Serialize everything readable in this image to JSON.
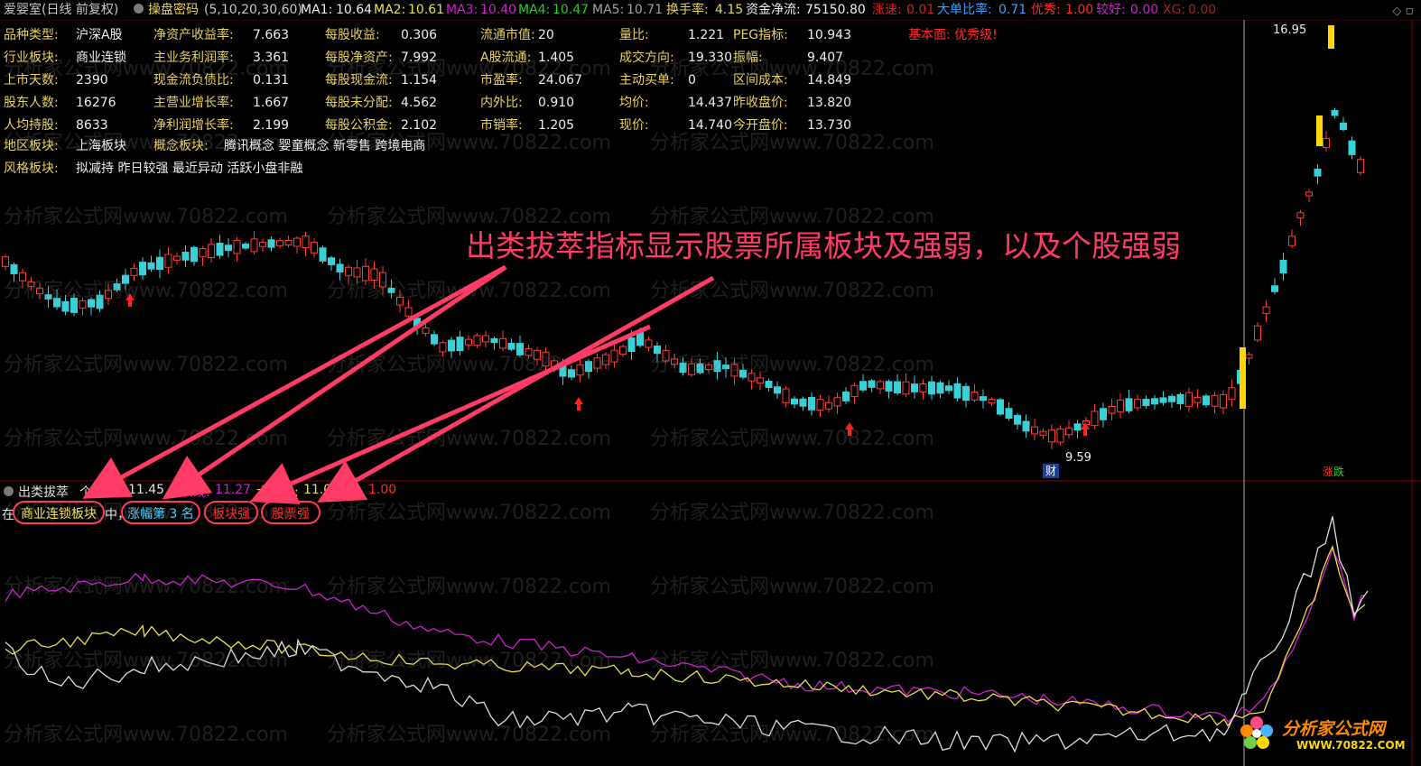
{
  "topbar": {
    "title": "爱婴室(日线 前复权)",
    "indicator_name": "操盘密码",
    "indicator_params": "(5,10,20,30,60)",
    "ma1_label": "MA1:",
    "ma1_value": "10.64",
    "ma2_label": "MA2:",
    "ma2_value": "10.61",
    "ma3_label": "MA3:",
    "ma3_value": "10.40",
    "ma4_label": "MA4:",
    "ma4_value": "10.47",
    "ma5_label": "MA5:",
    "ma5_value": "10.71",
    "turnover_label": "换手率:",
    "turnover_value": "4.15",
    "netflow_label": "资金净流:",
    "netflow_value": "75150.80",
    "speed_label": "涨速:",
    "speed_value": "0.01",
    "bigorder_label": "大单比率:",
    "bigorder_value": "0.71",
    "excellent_label": "优秀:",
    "excellent_value": "1.00",
    "better_label": "较好:",
    "better_value": "0.00",
    "xg_label": "XG:",
    "xg_value": "0.00",
    "right_icon": "diamond-icon"
  },
  "info": {
    "col1": [
      {
        "label": "品种类型:",
        "value": "沪深A股"
      },
      {
        "label": "行业板块:",
        "value": "商业连锁"
      },
      {
        "label": "上市天数:",
        "value": "2390"
      },
      {
        "label": "股东人数:",
        "value": "16276"
      },
      {
        "label": "人均持股:",
        "value": "8633"
      }
    ],
    "col2": [
      {
        "label": "净资产收益率:",
        "value": "7.663"
      },
      {
        "label": "主业务利润率:",
        "value": "3.361"
      },
      {
        "label": "现金流负债比:",
        "value": "0.131"
      },
      {
        "label": "主营业增长率:",
        "value": "1.667"
      },
      {
        "label": "净利润增长率:",
        "value": "2.199"
      }
    ],
    "col3": [
      {
        "label": "每股收益:",
        "value": "0.306"
      },
      {
        "label": "每股净资产:",
        "value": "7.992"
      },
      {
        "label": "每股现金流:",
        "value": "1.154"
      },
      {
        "label": "每股未分配:",
        "value": "4.562"
      },
      {
        "label": "每股公积金:",
        "value": "2.102"
      }
    ],
    "col4": [
      {
        "label": "流通市值:",
        "value": "20"
      },
      {
        "label": "A股流通:",
        "value": "1.405"
      },
      {
        "label": "市盈率:",
        "value": "24.067"
      },
      {
        "label": "内外比:",
        "value": "0.910"
      },
      {
        "label": "市销率:",
        "value": "1.205"
      }
    ],
    "col5": [
      {
        "label": "量比:",
        "value": "1.221"
      },
      {
        "label": "成交方向:",
        "value": "19.330"
      },
      {
        "label": "主动买单:",
        "value": "0"
      },
      {
        "label": "均价:",
        "value": "14.437"
      },
      {
        "label": "现价:",
        "value": "14.740"
      }
    ],
    "col6": [
      {
        "label": "PEG指标:",
        "value": "10.943"
      },
      {
        "label": "振幅:",
        "value": "9.407"
      },
      {
        "label": "区间成本:",
        "value": "14.849"
      },
      {
        "label": "昨收盘价:",
        "value": "13.820"
      },
      {
        "label": "今开盘价:",
        "value": "13.730"
      }
    ],
    "fundamental": "基本面: 优秀级!",
    "region_label": "地区板块:",
    "region_value": "上海板块",
    "concept_label": "概念板块:",
    "concept_value": "腾讯概念 婴童概念 新零售 跨境电商",
    "style_label": "风格板块:",
    "style_value": "拟减持 昨日较强 最近异动 活跃小盘非融"
  },
  "chart_labels": {
    "high": "16.95",
    "low": "9.59",
    "cai": "财",
    "zhang": "涨",
    "die": "跌"
  },
  "annotation": "出类拔萃指标显示股票所属板块及强弱，以及个股强弱",
  "sub": {
    "name": "出类拔萃",
    "line1_label": "个股线:",
    "line1_value": "11.45",
    "line2_label": "板块线:",
    "line2_value": "11.27",
    "line3_label": "大盘线:",
    "line3_value": "11.00",
    "extra_value": "1.00",
    "row2_prefix": "在",
    "tag1": "商业连锁板块",
    "row2_mid": "中，",
    "tag2": "涨幅第 3 名",
    "tag3": "板块强",
    "tag4": "股票强"
  },
  "watermark": "分析家公式网www.70822.com",
  "logo": {
    "name": "分析家公式网",
    "url": "WWW.70822.COM"
  },
  "colors": {
    "bg": "#000000",
    "up": "#ff3b3b",
    "down": "#39d0d8",
    "label": "#e8d25e",
    "ma_white": "#dddddd",
    "ma_yellow": "#e8e04a",
    "ma_magenta": "#d020d0",
    "ma_green": "#20c020",
    "ma_gray": "#a0a0a0",
    "accent_pink": "#ff3b66"
  }
}
